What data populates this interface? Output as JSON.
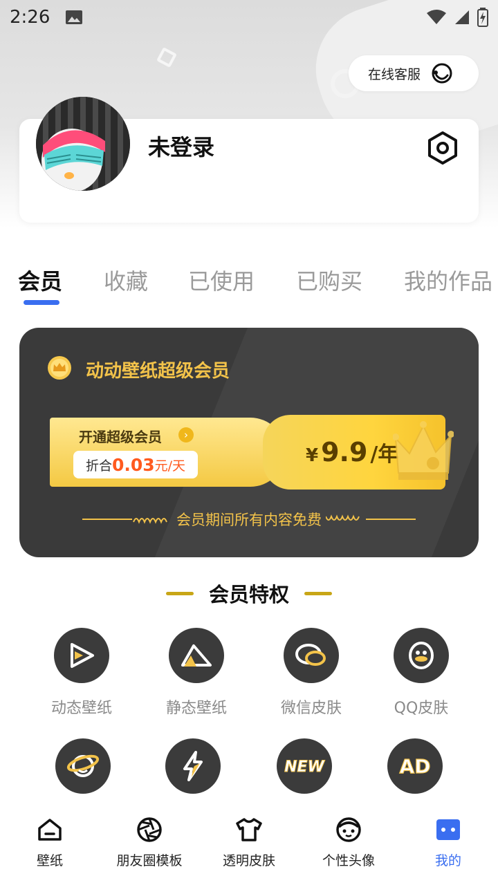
{
  "status_bar": {
    "time": "2:26"
  },
  "header": {
    "service_label": "在线客服"
  },
  "profile": {
    "username": "未登录"
  },
  "tabs": [
    {
      "label": "会员",
      "active": true
    },
    {
      "label": "收藏",
      "active": false
    },
    {
      "label": "已使用",
      "active": false
    },
    {
      "label": "已购买",
      "active": false
    },
    {
      "label": "我的作品",
      "active": false
    }
  ],
  "vip_card": {
    "title": "动动壁纸超级会员",
    "open_label": "开通超级会员",
    "per_day_prefix": "折合",
    "per_day_price": "0.03",
    "per_day_unit": "元/天",
    "year_symbol": "¥",
    "year_price": "9.9",
    "year_unit": "/年",
    "free_text": "会员期间所有内容免费"
  },
  "privileges": {
    "title": "会员特权",
    "items": [
      {
        "label": "动态壁纸",
        "icon": "play-icon"
      },
      {
        "label": "静态壁纸",
        "icon": "mountain-icon"
      },
      {
        "label": "微信皮肤",
        "icon": "chat-icon"
      },
      {
        "label": "QQ皮肤",
        "icon": "penguin-icon"
      },
      {
        "label": "",
        "icon": "planet-icon"
      },
      {
        "label": "",
        "icon": "lightning-icon"
      },
      {
        "label": "",
        "icon": "new-icon",
        "badge": "NEW"
      },
      {
        "label": "",
        "icon": "ad-icon",
        "badge": "AD"
      }
    ]
  },
  "bottom_nav": [
    {
      "label": "壁纸",
      "icon": "home-icon"
    },
    {
      "label": "朋友圈模板",
      "icon": "aperture-icon"
    },
    {
      "label": "透明皮肤",
      "icon": "tshirt-icon"
    },
    {
      "label": "个性头像",
      "icon": "face-icon"
    },
    {
      "label": "我的",
      "icon": "profile-icon",
      "active": true
    }
  ],
  "colors": {
    "accent": "#3a6ef0",
    "gold": "#f3c34a",
    "card_dark": "#3a3a3a",
    "price_orange": "#ff5a1f"
  }
}
